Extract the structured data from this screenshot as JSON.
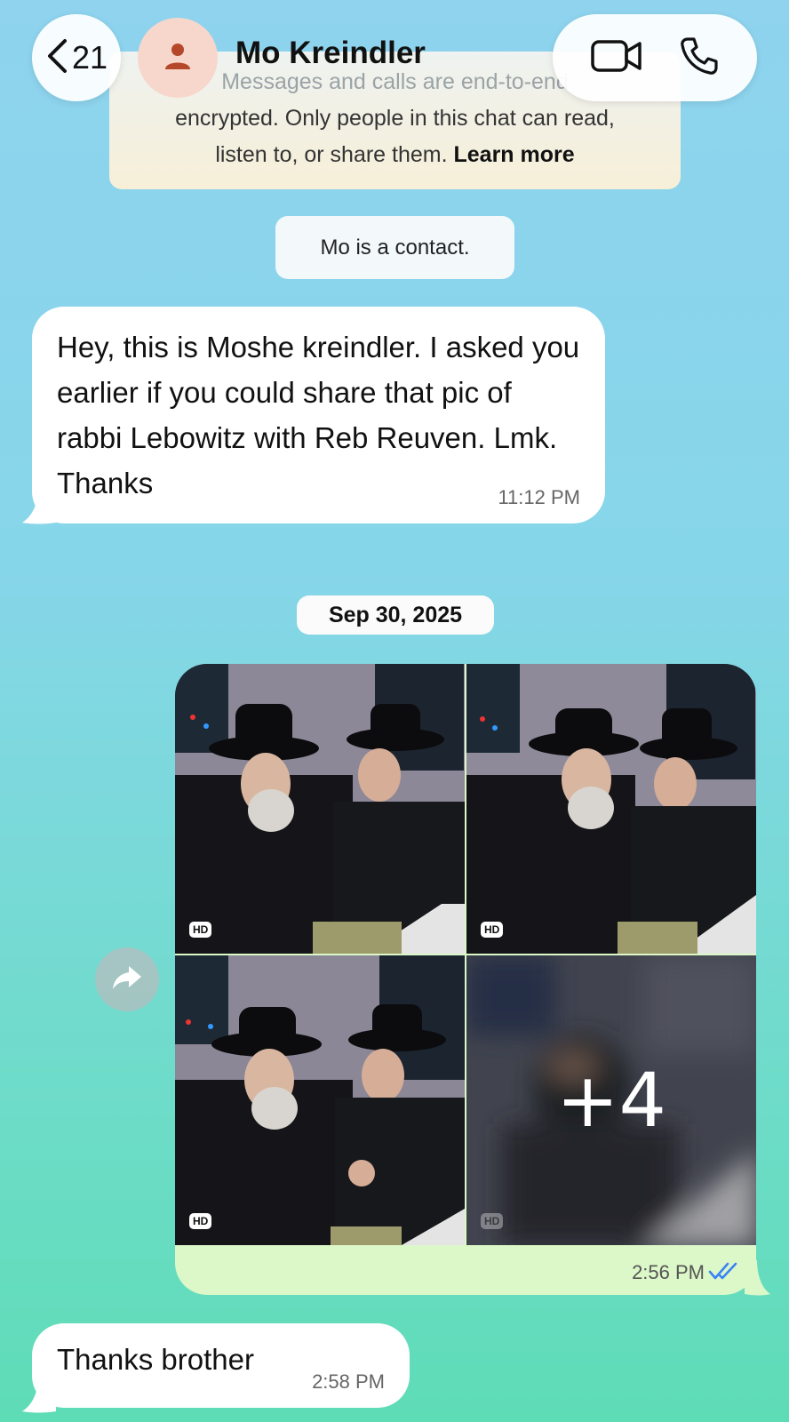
{
  "header": {
    "back_count": "21",
    "contact_name": "Mo Kreindler",
    "icons": [
      "chevron-left-icon",
      "person-icon",
      "video-camera-icon",
      "phone-icon"
    ]
  },
  "encryption_notice": {
    "line1": "Messages and calls are end-to-end",
    "line2": "encrypted. Only people in this chat can read,",
    "line3": "listen to, or share them.",
    "learn_more": "Learn more"
  },
  "system_message": "Mo is a contact.",
  "messages": [
    {
      "direction": "incoming",
      "text": "Hey, this is Moshe kreindler. I asked you earlier if you could share that pic of rabbi Lebowitz with Reb Reuven. Lmk. Thanks",
      "time": "11:12 PM"
    },
    {
      "direction": "outgoing",
      "type": "media",
      "photos": [
        {
          "badge": "HD"
        },
        {
          "badge": "HD"
        },
        {
          "badge": "HD"
        },
        {
          "badge": "HD",
          "overlay": "+4"
        }
      ],
      "time": "2:56 PM",
      "status": "read"
    },
    {
      "direction": "incoming",
      "text": "Thanks brother",
      "time": "2:58 PM"
    }
  ],
  "date_separator": "Sep 30, 2025",
  "colors": {
    "outgoing_bubble": "#dcf8c8",
    "incoming_bubble": "#ffffff",
    "read_ticks": "#3b82f6",
    "avatar_bg": "#f7d7cc",
    "avatar_icon": "#b5472a"
  }
}
